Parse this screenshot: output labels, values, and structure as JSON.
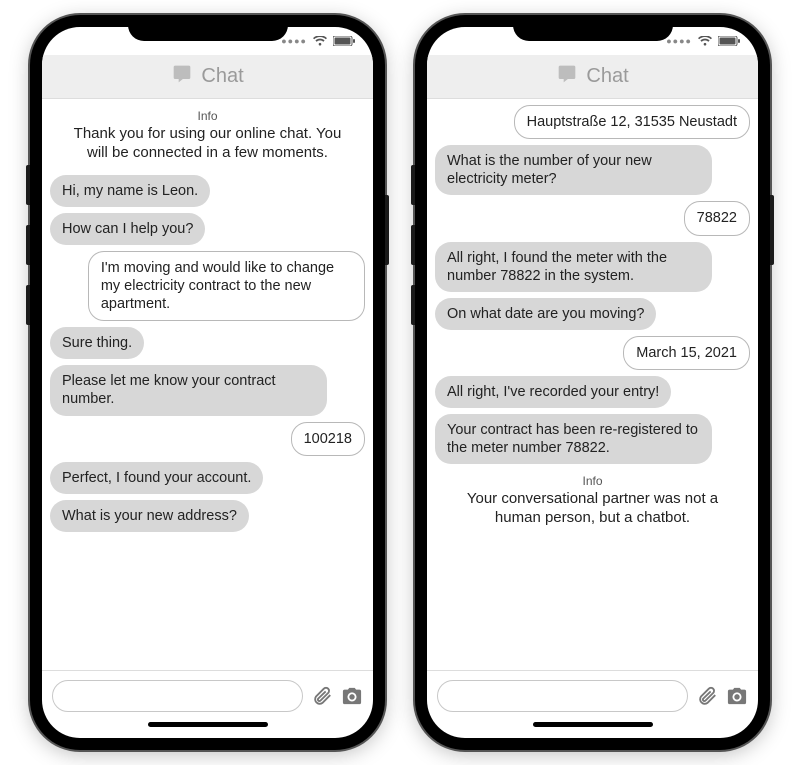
{
  "header_title": "Chat",
  "info_label": "Info",
  "composer_placeholder": "",
  "phones": [
    {
      "intro_info": "Thank you for using our online chat. You will be connected in a few moments.",
      "messages": [
        {
          "from": "agent",
          "text": "Hi, my name is Leon."
        },
        {
          "from": "agent",
          "text": "How can I help you?"
        },
        {
          "from": "user",
          "text": "I'm moving and would like to change my electricity contract to the new apartment."
        },
        {
          "from": "agent",
          "text": "Sure thing."
        },
        {
          "from": "agent",
          "text": "Please let me know your contract number."
        },
        {
          "from": "user",
          "text": "100218"
        },
        {
          "from": "agent",
          "text": "Perfect, I found your account."
        },
        {
          "from": "agent",
          "text": "What is your new address?"
        }
      ],
      "outro_info": null
    },
    {
      "intro_info": null,
      "messages": [
        {
          "from": "user",
          "text": "Hauptstraße 12, 31535 Neustadt"
        },
        {
          "from": "agent",
          "text": "What is the number of your new electricity meter?"
        },
        {
          "from": "user",
          "text": "78822"
        },
        {
          "from": "agent",
          "text": "All right, I found the meter with the number 78822 in the system."
        },
        {
          "from": "agent",
          "text": "On what date are you moving?"
        },
        {
          "from": "user",
          "text": "March 15, 2021"
        },
        {
          "from": "agent",
          "text": "All right, I've recorded your entry!"
        },
        {
          "from": "agent",
          "text": "Your contract has been re-registered to the meter number 78822."
        }
      ],
      "outro_info": "Your conversational partner was not a human person, but a chatbot."
    }
  ]
}
